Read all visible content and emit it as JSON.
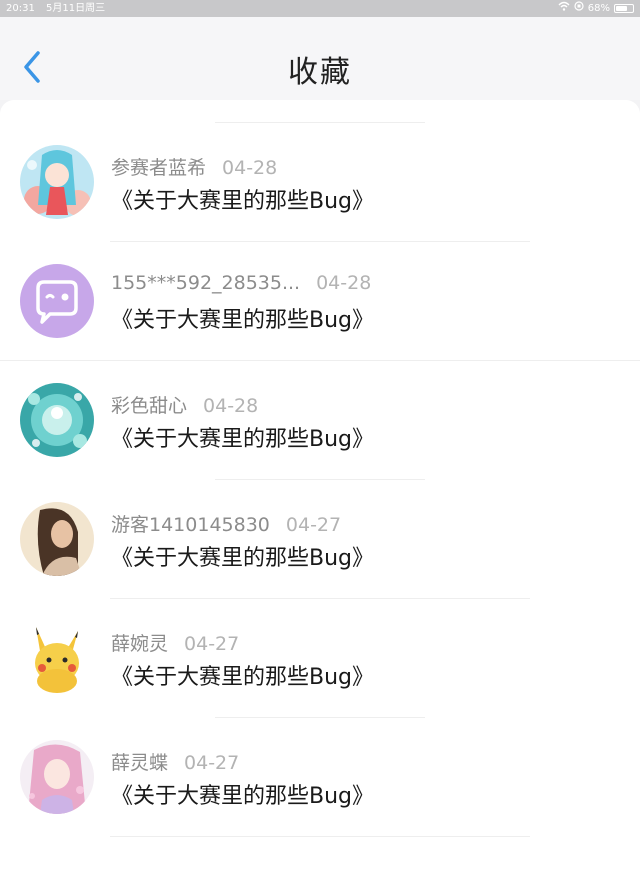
{
  "status_bar": {
    "time": "20:31",
    "date": "5月11日周三",
    "battery": "68%",
    "battery_level": 0.68
  },
  "header": {
    "title": "收藏"
  },
  "favorites": [
    {
      "user": "参赛者蓝希",
      "date": "04-28",
      "title": "《关于大赛里的那些Bug》",
      "avatar": "anime-girl-blue-hair"
    },
    {
      "user": "155***592_28535...",
      "date": "04-28",
      "title": "《关于大赛里的那些Bug》",
      "avatar": "purple-chat-bubble"
    },
    {
      "user": "彩色甜心",
      "date": "04-28",
      "title": "《关于大赛里的那些Bug》",
      "avatar": "teal-floral"
    },
    {
      "user": "游客1410145830",
      "date": "04-27",
      "title": "《关于大赛里的那些Bug》",
      "avatar": "portrait-photo"
    },
    {
      "user": "薛婉灵",
      "date": "04-27",
      "title": "《关于大赛里的那些Bug》",
      "avatar": "pikachu"
    },
    {
      "user": "薛灵蝶",
      "date": "04-27",
      "title": "《关于大赛里的那些Bug》",
      "avatar": "anime-girl-pink-hair"
    }
  ],
  "colors": {
    "back_arrow": "#3b95e6",
    "username": "#8c8c8c",
    "date": "#b3b3b3",
    "title_text": "#1a1a1a"
  }
}
